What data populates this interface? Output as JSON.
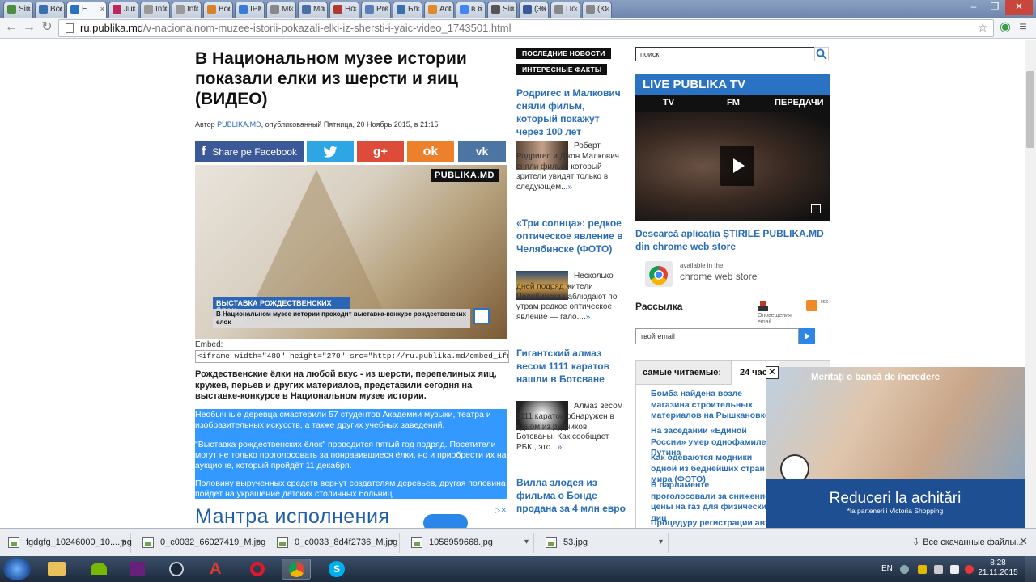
{
  "browser": {
    "tabs": [
      {
        "label": "Sim",
        "color": "#4a8f3c"
      },
      {
        "label": "Все",
        "color": "#3a6fb0"
      },
      {
        "label": "Е",
        "color": "#2a72c2",
        "active": true
      },
      {
        "label": "Juri",
        "color": "#c0245a"
      },
      {
        "label": "Info",
        "color": "#999999"
      },
      {
        "label": "Info",
        "color": "#999999"
      },
      {
        "label": "Все",
        "color": "#d9802a"
      },
      {
        "label": "IPN",
        "color": "#3a7bd5"
      },
      {
        "label": "MC",
        "color": "#888888"
      },
      {
        "label": "Mo",
        "color": "#4a6fa5"
      },
      {
        "label": "Нo",
        "color": "#b03a2e"
      },
      {
        "label": "Pro",
        "color": "#5a7fb8"
      },
      {
        "label": "Бл",
        "color": "#3a6fb0"
      },
      {
        "label": "Act",
        "color": "#e08a2a"
      },
      {
        "label": "в б",
        "color": "#4285f4"
      },
      {
        "label": "Sim",
        "color": "#555555"
      },
      {
        "label": "(36)",
        "color": "#3b5998"
      },
      {
        "label": "По",
        "color": "#888888"
      },
      {
        "label": "(КС",
        "color": "#888888"
      }
    ],
    "url_host": "ru.publika.md",
    "url_path": "/v-nacionalnom-muzee-istorii-pokazali-elki-iz-shersti-i-yaic-video_1743501.html"
  },
  "article": {
    "title": "В Национальном музее истории показали елки из шерсти и яиц (ВИДЕО)",
    "byline_prefix": "Автор",
    "author": "PUBLIKA.MD",
    "byline_suffix": ", опубликованный Пятница, 20 Ноябрь 2015, в 21:15",
    "share_facebook": "Share pe Facebook",
    "share_colors": {
      "facebook": "#3b5998",
      "twitter": "#2ea6e4",
      "gplus": "#dd4b39",
      "odnoklassniki": "#ed812b",
      "vk": "#4d75a3"
    },
    "video_logo": "PUBLIKA.MD",
    "video_caption_title": "ВЫСТАВКА РОЖДЕСТВЕНСКИХ ЁЛОК",
    "video_caption_text": "В Национальном музее истории проходит выставка-конкурс рождественских елок",
    "embed_label": "Embed:",
    "embed_code": "<iframe width=\"480\" height=\"270\" src=\"http://ru.publika.md/embed_iframe.php?id=",
    "lead": "Рождественские ёлки на любой вкус - из шерсти, перепелиных яиц, кружев, перьев и других материалов, представили сегодня на выставке-конкурсе в Национальном музее истории.",
    "paragraphs": [
      "Необычные деревца смастерили 57 студентов Академии музыки, театра и изобразительных искусств, а также других учебных заведений.",
      "\"Выставка рождественских ёлок\" проводится пятый год подряд. Посетители могут не только проголосовать за понравившиеся ёлки, но и приобрести их на аукционе, который пройдёт 11 декабря.",
      "Половину вырученных средств вернут создателям деревьев, другая половина пойдёт на украшение детских столичных больниц."
    ],
    "ad_text": "Мантра исполнения"
  },
  "news": {
    "tag_latest": "ПОСЛЕДНИЕ НОВОСТИ",
    "tag_facts": "ИНТЕРЕСНЫЕ ФАКТЫ",
    "items": [
      {
        "title": "Родригес и Малкович сняли фильм, который покажут через 100 лет",
        "snippet": "Роберт Родригес и Джон Малкович сняли фильм, который зрители увидят только в следующем...",
        "more": "»"
      },
      {
        "title": "«Три солнца»: редкое оптическое явление в Челябинске (ФОТО)",
        "snippet": "Несколько дней подряд жители Челябинска наблюдают по утрам редкое оптическое явление — гало....",
        "more": "»"
      },
      {
        "title": "Гигантский алмаз весом 1111 каратов нашли в Ботсване",
        "snippet": "Алмаз весом 1111 каратов обнаружен в одном из рудников Ботсваны. Как сообщает РБК , это...",
        "more": "»"
      },
      {
        "title": "Вилла злодея из фильма о Бонде продана за 4 млн евро",
        "snippet": "",
        "more": ""
      }
    ]
  },
  "sidebar": {
    "search_placeholder": "поиск",
    "tv_title": "LIVE PUBLIKA TV",
    "tv_tabs": [
      "TV",
      "FM",
      "ПЕРЕДАЧИ"
    ],
    "app_link": "Descarcă aplicația ȘTIRILE PUBLIKA.MD din chrome web store",
    "cws_small": "available in the",
    "cws_big": "chrome web store",
    "newsletter_title": "Рассылка",
    "alerts_label": "Оповещения email",
    "rss_label": "rss",
    "email_placeholder": "твой email",
    "popular_tab1": "самые читаемые:",
    "popular_tab2": "24 час",
    "popular_items": [
      "Бомба найдена возле магазина строительных материалов на Рышкановке",
      "На заседании «Единой России» умер однофамилец Путина",
      "Как одеваются модники одной из беднейших стран мира (ФОТО)",
      "В парламенте проголосовали за снижение цены на газ для физических лиц",
      "Процедуру регистрации автомобилей"
    ]
  },
  "overlay_ad": {
    "headline": "Meritați o bancă de încredere",
    "big": "Reduceri la achitări",
    "small": "*la parteneriii Victoria Shopping",
    "close": "✕"
  },
  "downloads": {
    "items": [
      "fgdgfg_10246000_10....jpg",
      "0_c0032_66027419_M.jpg",
      "0_c0033_8d4f2736_M.jpg",
      "1058959668.jpg",
      "53.jpg"
    ],
    "show_all": "Все скачанные файлы..."
  },
  "taskbar": {
    "lang": "EN",
    "time": "8:28",
    "date": "21.11.2015"
  }
}
